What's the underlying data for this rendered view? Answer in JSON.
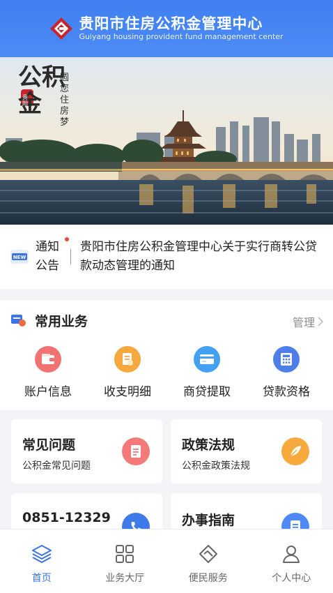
{
  "header": {
    "title_cn": "贵阳市住房公积金管理中心",
    "title_en": "Guiyang housing provident fund management center",
    "logo": "logo-diamond",
    "brand_color": "#4a86f3"
  },
  "banner": {
    "calligraphy_main": "公积金",
    "calligraphy_sub": "圆您住房梦",
    "seal": "贵阳"
  },
  "notice": {
    "label_line1": "通知",
    "label_line2": "公告",
    "text": "贵阳市住房公积金管理中心关于实行商转公贷款动态管理的通知",
    "icon": "new-icon"
  },
  "services": {
    "title": "常用业务",
    "manage_label": "管理",
    "items": [
      {
        "label": "账户信息",
        "icon": "wallet-icon",
        "color": "#f06b6b"
      },
      {
        "label": "收支明细",
        "icon": "bill-icon",
        "color": "#f5a53a"
      },
      {
        "label": "商贷提取",
        "icon": "card-icon",
        "color": "#3e9bf0"
      },
      {
        "label": "贷款资格",
        "icon": "calculator-icon",
        "color": "#4a78e8"
      }
    ]
  },
  "cards": [
    {
      "title": "常见问题",
      "subtitle": "公积金常见问题",
      "icon": "document-icon",
      "color": "#f06b6b"
    },
    {
      "title": "政策法规",
      "subtitle": "公积金政策法规",
      "icon": "feather-icon",
      "color": "#f5a53a"
    },
    {
      "title": "0851-12329",
      "subtitle": "",
      "icon": "phone-icon",
      "color": "#3e7be8"
    },
    {
      "title": "办事指南",
      "subtitle": "",
      "icon": "guide-icon",
      "color": "#4a86f3"
    }
  ],
  "bottom_nav": {
    "items": [
      {
        "label": "首页",
        "icon": "layers-icon",
        "active": true
      },
      {
        "label": "业务大厅",
        "icon": "grid-icon",
        "active": false
      },
      {
        "label": "便民服务",
        "icon": "handshake-icon",
        "active": false
      },
      {
        "label": "个人中心",
        "icon": "user-icon",
        "active": false
      }
    ],
    "active_color": "#3b74e8"
  }
}
